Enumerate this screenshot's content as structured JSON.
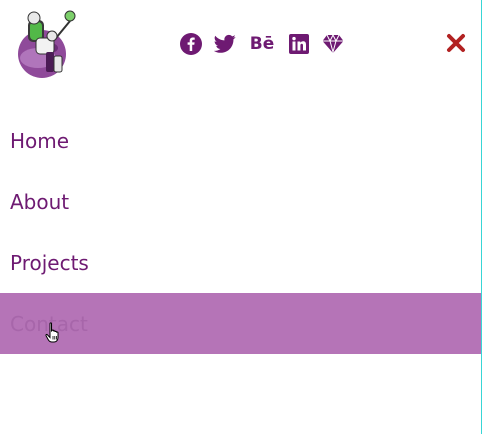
{
  "header": {
    "logo_alt": "astronaut logo",
    "socials": [
      {
        "name": "facebook",
        "icon": "facebook-icon"
      },
      {
        "name": "twitter",
        "icon": "twitter-icon"
      },
      {
        "name": "behance",
        "icon": "behance-icon",
        "text": "Bē"
      },
      {
        "name": "linkedin",
        "icon": "linkedin-icon"
      },
      {
        "name": "gem",
        "icon": "diamond-icon"
      }
    ],
    "close_icon": "close-icon"
  },
  "nav": {
    "items": [
      {
        "label": "Home"
      },
      {
        "label": "About"
      },
      {
        "label": "Projects"
      },
      {
        "label": "Contact",
        "active": true
      }
    ]
  },
  "colors": {
    "brand": "#6e1a72",
    "active_bg": "#b574b7",
    "close": "#b22222",
    "edge": "#38d6d6"
  }
}
